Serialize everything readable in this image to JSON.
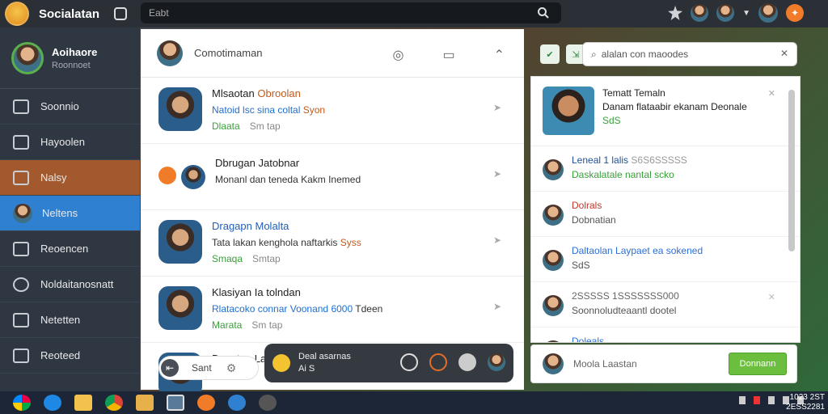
{
  "app": {
    "title": "Socialatan"
  },
  "top_search": {
    "placeholder": "Eabt"
  },
  "sidebar": {
    "profile": {
      "name": "Aoihaore",
      "subtitle": "Roonnoet"
    },
    "items": [
      {
        "label": "Soonnio",
        "icon": "home-icon"
      },
      {
        "label": "Hayoolen",
        "icon": "chat-icon"
      },
      {
        "label": "Nalsy",
        "icon": "grid-icon"
      },
      {
        "label": "Neltens",
        "icon": "user-icon"
      },
      {
        "label": "Reoencen",
        "icon": "house-icon"
      },
      {
        "label": "Noldaitanosnatt",
        "icon": "search-icon"
      },
      {
        "label": "Netetten",
        "icon": "list-icon"
      },
      {
        "label": "Reoteed",
        "icon": "document-icon"
      }
    ]
  },
  "list_header": {
    "title": "Comotimaman"
  },
  "conversations": [
    {
      "name": "Mlsaotan",
      "name_accent": "Obroolan",
      "msg_blue": "Natoid lsc sina coltal",
      "msg_orange": "Syon",
      "tag": "Dlaata",
      "time": "Sm tap"
    },
    {
      "name": "Dbrugan Jatobnar",
      "msg": "Monanl dan teneda",
      "msg_tail": "Kakm Inemed",
      "tag": "",
      "time": ""
    },
    {
      "name": "Dragapn",
      "name_accent": "Molalta",
      "msg": "Tata lakan kenghola naftarkis",
      "msg_orange": "Syss",
      "tag": "Smaqa",
      "time": "Smtap"
    },
    {
      "name": "Klasiyan Ia tolndan",
      "msg_blue": "Rlatacoko connar Voonand",
      "msg_num": "6000",
      "msg_tail": "Tdeen",
      "tag": "Marata",
      "time": "Sm tap"
    },
    {
      "name": "Dam tan Latanan",
      "msg": "",
      "tag": "",
      "time": ""
    }
  ],
  "compose": {
    "label": "Sant"
  },
  "call_bar": {
    "line1": "Deal asarnas",
    "line2": "Ai S"
  },
  "right_search": {
    "placeholder": "alalan con maoodes"
  },
  "chat": {
    "header": {
      "name": "Tematt Temaln",
      "msg": "Danam flataabir ekanam Deonale",
      "tag": "SdS"
    },
    "messages": [
      {
        "name": "Leneal 1 lalis",
        "name_extra": "S6S6SSSSS",
        "body": "Daskalatale nantal scko",
        "body_style": "green"
      },
      {
        "name": "Dolrals",
        "name_style": "red",
        "body": "Dobnatian",
        "body_style": "gray"
      },
      {
        "name": "Daltaolan Laypaet ea sokened",
        "name_style": "lb",
        "body": "SdS",
        "body_style": "gray"
      },
      {
        "name": "2SSSSS 1SSSSSSS000",
        "name_style": "gray",
        "body": "Soonnoludteaantl dootel",
        "body_style": "gray"
      },
      {
        "name": "Doleals",
        "name_style": "lb",
        "body": "",
        "body_style": "gray"
      }
    ]
  },
  "reply": {
    "placeholder": "Moola Laastan",
    "send_label": "Donnann"
  },
  "clock": {
    "time": "1023 2ST",
    "date": "2ESS2281"
  }
}
